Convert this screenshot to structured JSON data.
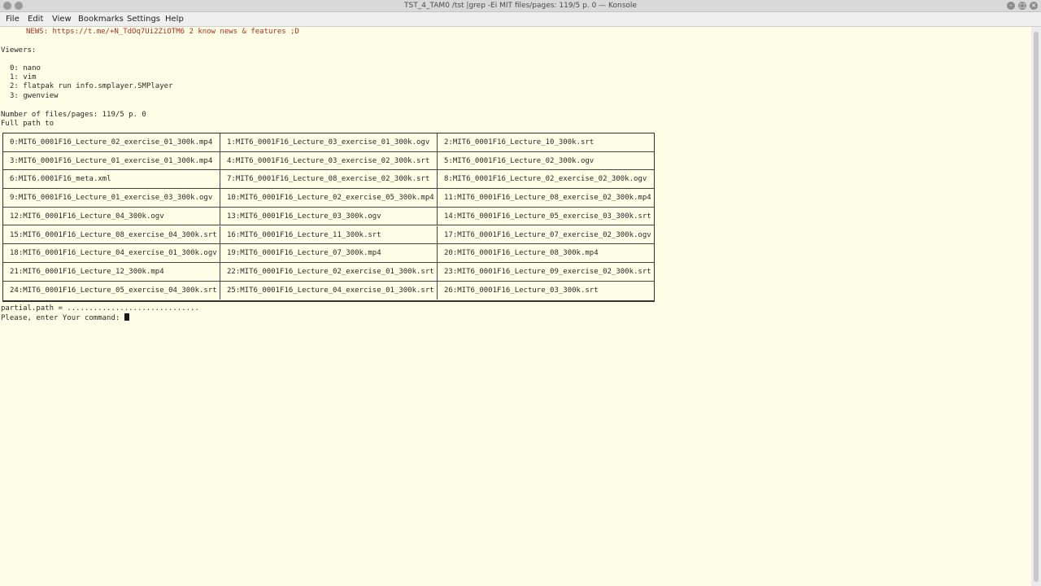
{
  "window": {
    "title": "TST_4_TAM0 /tst |grep -Ei MIT files/pages: 119/5 p. 0 — Konsole",
    "buttons": {
      "minimize": "–",
      "maximize": "□",
      "close": "×"
    }
  },
  "menu": [
    "File",
    "Edit",
    "View",
    "Bookmarks",
    "Settings",
    "Help"
  ],
  "terminal": {
    "news": "NEWS: https://t.me/+N_TdOq7Ui2ZiOTM6 2 know news & features ;D",
    "viewers_label": "Viewers:",
    "viewers": [
      "0: nano",
      "1: vim",
      "2: flatpak run info.smplayer.SMPlayer",
      "3: gwenview"
    ],
    "files_count": "Number of files/pages: 119/5 p. 0",
    "full_path": "Full path to",
    "file_rows": [
      [
        "0:MIT6_0001F16_Lecture_02_exercise_01_300k.mp4",
        "1:MIT6_0001F16_Lecture_03_exercise_01_300k.ogv",
        "2:MIT6_0001F16_Lecture_10_300k.srt"
      ],
      [
        "3:MIT6_0001F16_Lecture_01_exercise_01_300k.mp4",
        "4:MIT6_0001F16_Lecture_03_exercise_02_300k.srt",
        "5:MIT6_0001F16_Lecture_02_300k.ogv"
      ],
      [
        "6:MIT6.0001F16_meta.xml",
        "7:MIT6_0001F16_Lecture_08_exercise_02_300k.srt",
        "8:MIT6_0001F16_Lecture_02_exercise_02_300k.ogv"
      ],
      [
        "9:MIT6_0001F16_Lecture_01_exercise_03_300k.ogv",
        "10:MIT6_0001F16_Lecture_02_exercise_05_300k.mp4",
        "11:MIT6_0001F16_Lecture_08_exercise_02_300k.mp4"
      ],
      [
        "12:MIT6_0001F16_Lecture_04_300k.ogv",
        "13:MIT6_0001F16_Lecture_03_300k.ogv",
        "14:MIT6_0001F16_Lecture_05_exercise_03_300k.srt"
      ],
      [
        "15:MIT6_0001F16_Lecture_08_exercise_04_300k.srt",
        "16:MIT6_0001F16_Lecture_11_300k.srt",
        "17:MIT6_0001F16_Lecture_07_exercise_02_300k.ogv"
      ],
      [
        "18:MIT6_0001F16_Lecture_04_exercise_01_300k.ogv",
        "19:MIT6_0001F16_Lecture_07_300k.mp4",
        "20:MIT6_0001F16_Lecture_08_300k.mp4"
      ],
      [
        "21:MIT6_0001F16_Lecture_12_300k.mp4",
        "22:MIT6_0001F16_Lecture_02_exercise_01_300k.srt",
        "23:MIT6_0001F16_Lecture_09_exercise_02_300k.srt"
      ],
      [
        "24:MIT6_0001F16_Lecture_05_exercise_04_300k.srt",
        "25:MIT6_0001F16_Lecture_04_exercise_01_300k.srt",
        "26:MIT6_0001F16_Lecture_03_300k.srt"
      ]
    ],
    "partial_path": "partial.path = ..............................",
    "prompt": "Please, enter Your command: "
  },
  "colors": {
    "background": "#fefee6",
    "news": "#b03020",
    "text": "#2a2a2a"
  }
}
